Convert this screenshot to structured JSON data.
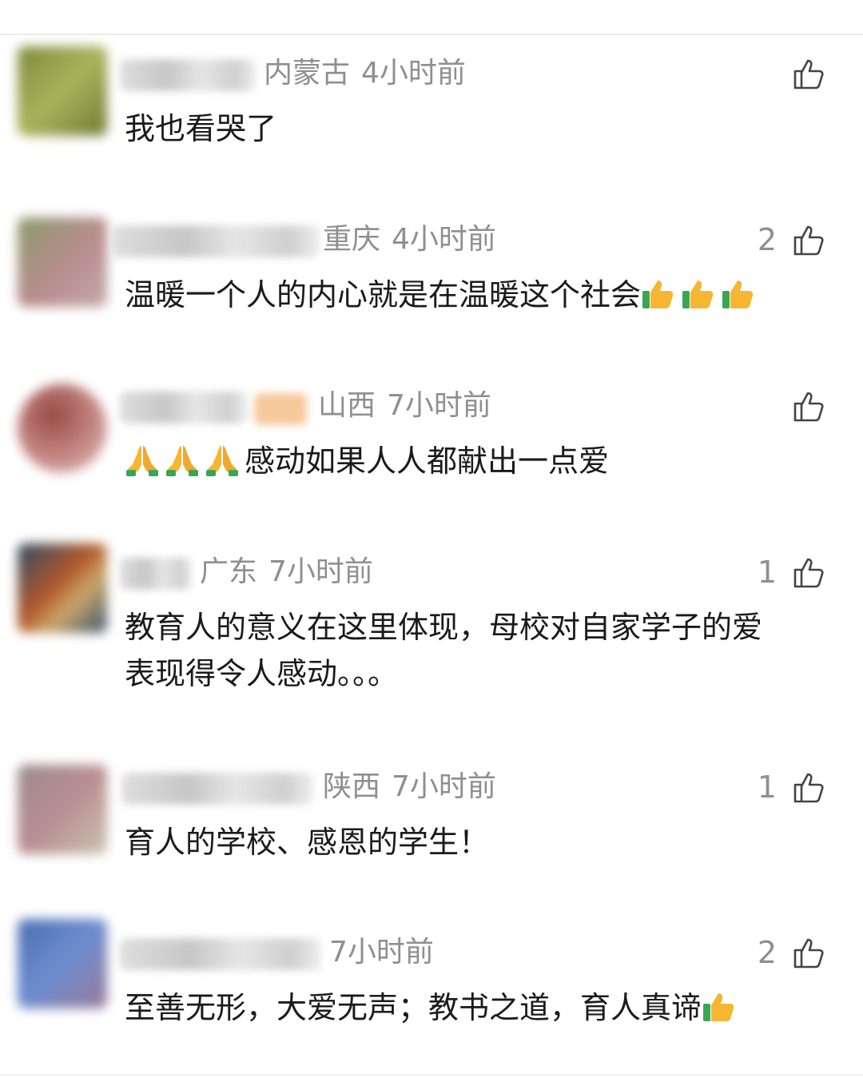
{
  "comments": [
    {
      "location": "内蒙古",
      "time": "4小时前",
      "likes": "",
      "text": "我也看哭了",
      "emoji_after": 0,
      "emoji_before": 0
    },
    {
      "location": "重庆",
      "time": "4小时前",
      "likes": "2",
      "text": "温暖一个人的内心就是在温暖这个社会",
      "emoji_after": 3,
      "emoji_before": 0,
      "emoji_name": "thumbs-up-emoji"
    },
    {
      "location": "山西",
      "time": "7小时前",
      "likes": "",
      "text": "感动如果人人都献出一点爱",
      "emoji_after": 0,
      "emoji_before": 3,
      "emoji_name": "praying-hands-emoji"
    },
    {
      "location": "广东",
      "time": "7小时前",
      "likes": "1",
      "text": "教育人的意义在这里体现，母校对自家学子的爱",
      "text2": "表现得令人感动。。。"
    },
    {
      "location": "陕西",
      "time": "7小时前",
      "likes": "1",
      "text": "育人的学校、感恩的学生！"
    },
    {
      "location": "",
      "time": "7小时前",
      "likes": "2",
      "text": "至善无形，大爱无声；教书之道，育人真谛",
      "emoji_after": 1,
      "emoji_name": "thumbs-up-emoji"
    }
  ],
  "icons": {
    "like": "thumbs-up-outline-icon"
  },
  "colors": {
    "meta": "#8e8e93",
    "text": "#1a1a1a",
    "emoji_yellow": "#f5b731",
    "emoji_green": "#3aa655"
  }
}
